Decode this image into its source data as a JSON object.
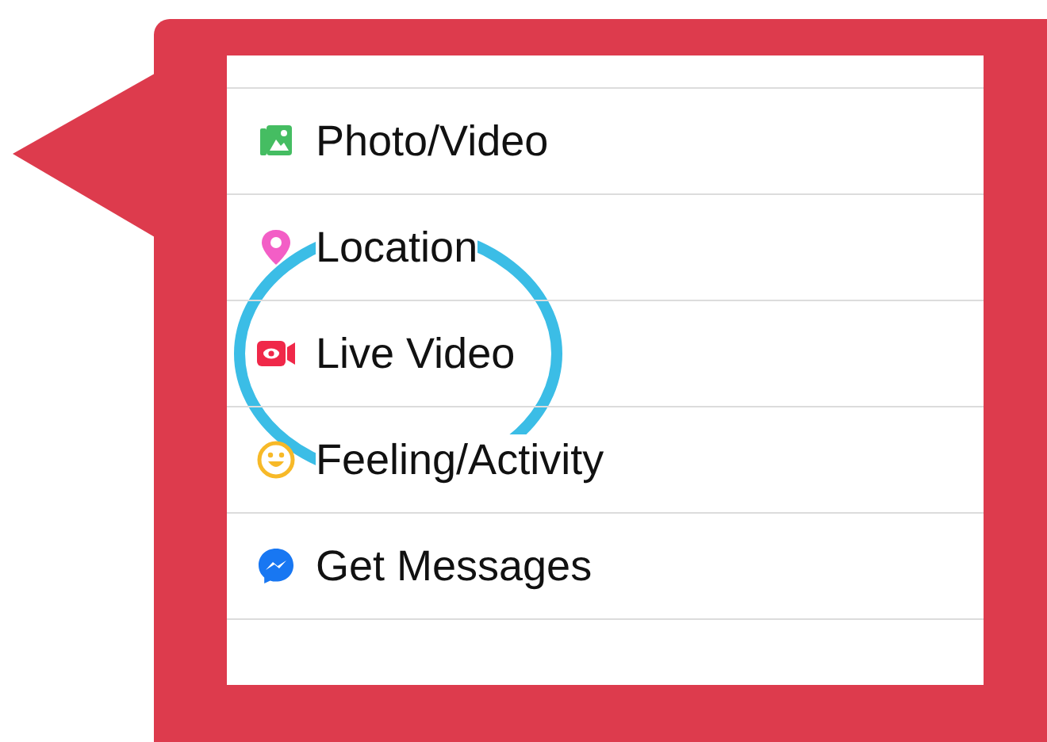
{
  "menu": {
    "items": [
      {
        "kind": "photo",
        "label": "Photo/Video",
        "circled": false
      },
      {
        "kind": "location",
        "label": "Location",
        "circled": false
      },
      {
        "kind": "live",
        "label": "Live Video",
        "circled": true
      },
      {
        "kind": "feeling",
        "label": "Feeling/Activity",
        "circled": false
      },
      {
        "kind": "messages",
        "label": "Get Messages",
        "circled": false
      }
    ]
  }
}
